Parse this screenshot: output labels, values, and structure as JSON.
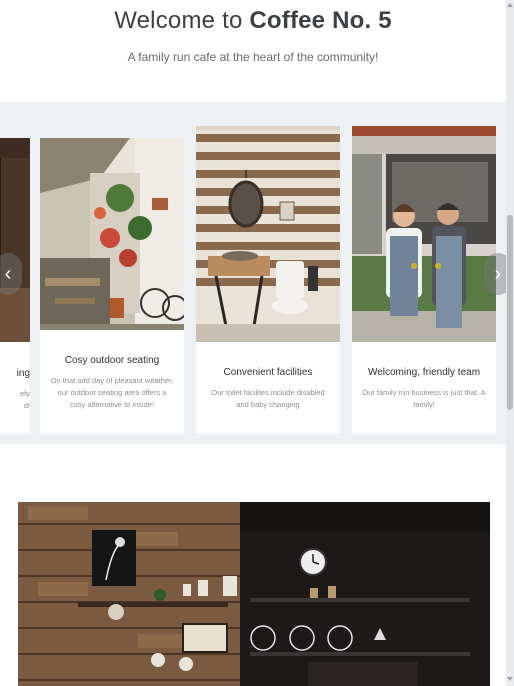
{
  "hero": {
    "title_prefix": "Welcome to ",
    "title_brand": "Coffee No. 5",
    "subtitle": "A family run cafe at the heart of the community!"
  },
  "carousel": {
    "prev_label": "‹",
    "next_label": "›",
    "partial_card": {
      "title_fragment": "ing",
      "text_fragment_1": "efy",
      "text_fragment_2": "d!"
    },
    "cards": [
      {
        "title": "Cosy outdoor seating",
        "text": "On that odd day of pleasant weather, our outdoor seating area offers a cosy alternative to inside!"
      },
      {
        "title": "Convenient facilities",
        "text": "Our toilet facilites include disabled and baby changing"
      },
      {
        "title": "Welcoming, friendly team",
        "text": "Our family run business is just that. A family!"
      }
    ]
  },
  "colors": {
    "page_bg": "#eef1f3",
    "card_bg": "#ffffff",
    "title_text": "#3c3f45",
    "muted_text": "#8a8e93"
  }
}
